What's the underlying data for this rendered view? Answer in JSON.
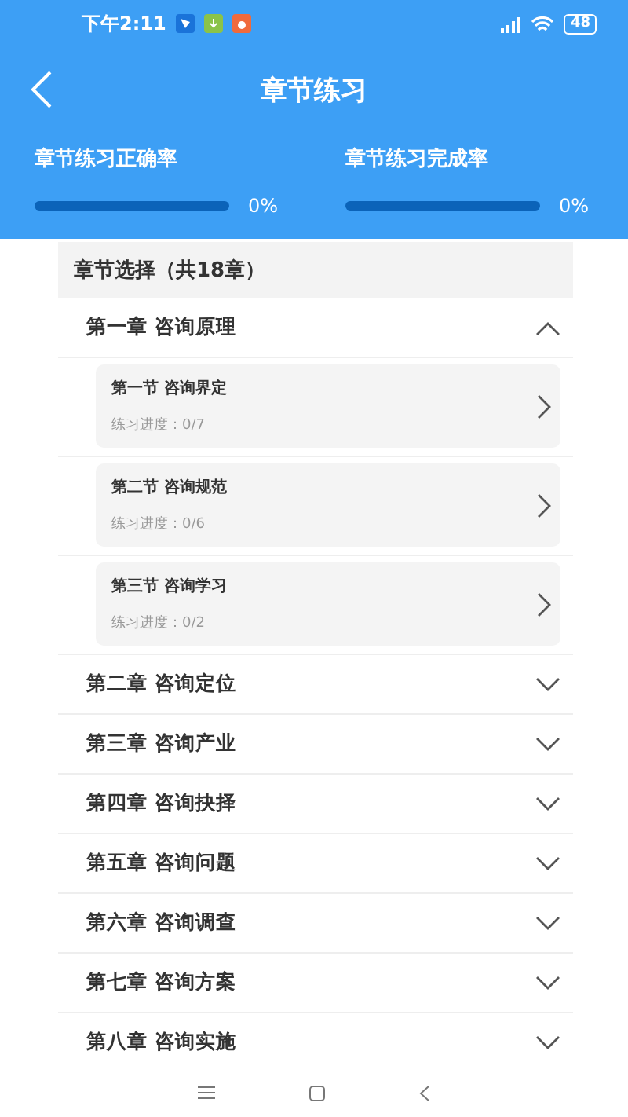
{
  "status_bar": {
    "time": "下午2:11",
    "battery": "48"
  },
  "header": {
    "title": "章节练习"
  },
  "stats": [
    {
      "label": "章节练习正确率",
      "level": 0,
      "reading": "0%"
    },
    {
      "label": "章节练习完成率",
      "level": 0,
      "reading": "0%"
    }
  ],
  "chapter_list": {
    "heading": "章节选择（共18章）",
    "chapters": [
      {
        "title": "第一章 咨询原理",
        "expanded": true,
        "sections": [
          {
            "title": "第一节 咨询界定",
            "progress": "练习进度：0/7"
          },
          {
            "title": "第二节 咨询规范",
            "progress": "练习进度：0/6"
          },
          {
            "title": "第三节 咨询学习",
            "progress": "练习进度：0/2"
          }
        ]
      },
      {
        "title": "第二章 咨询定位",
        "expanded": false
      },
      {
        "title": "第三章 咨询产业",
        "expanded": false
      },
      {
        "title": "第四章 咨询抉择",
        "expanded": false
      },
      {
        "title": "第五章 咨询问题",
        "expanded": false
      },
      {
        "title": "第六章 咨询调查",
        "expanded": false
      },
      {
        "title": "第七章 咨询方案",
        "expanded": false
      },
      {
        "title": "第八章 咨询实施",
        "expanded": false
      }
    ]
  }
}
